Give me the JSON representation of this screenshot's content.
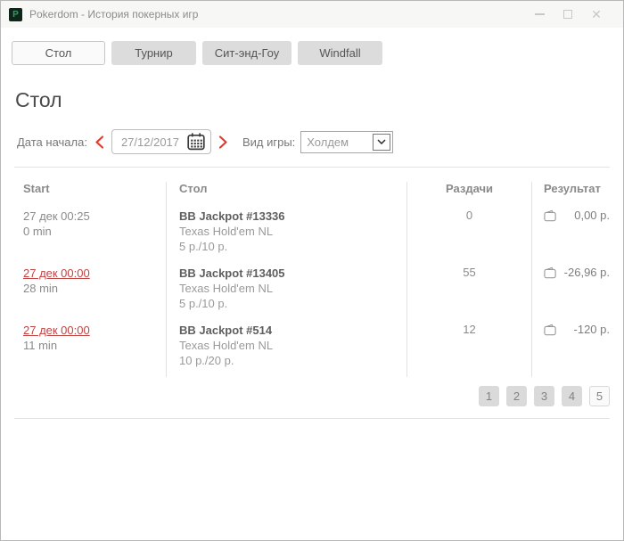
{
  "window": {
    "title": "Pokerdom - История покерных игр",
    "logo_letter": "P"
  },
  "tabs": [
    {
      "label": "Стол",
      "active": true
    },
    {
      "label": "Турнир",
      "active": false
    },
    {
      "label": "Сит-энд-Гоу",
      "active": false
    },
    {
      "label": "Windfall",
      "active": false
    }
  ],
  "page": {
    "heading": "Стол"
  },
  "filters": {
    "date_label": "Дата начала:",
    "date_value": "27/12/2017",
    "game_label": "Вид игры:",
    "game_value": "Холдем"
  },
  "table": {
    "headers": {
      "start": "Start",
      "table": "Стол",
      "hands": "Раздачи",
      "result": "Результат"
    },
    "rows": [
      {
        "start": "27 дек 00:25",
        "duration": "0 min",
        "name": "BB Jackpot #13336",
        "game": "Texas Hold'em NL",
        "stakes": "5 р./10 р.",
        "hands": "0",
        "result": "0,00 р."
      },
      {
        "start": "27 дек 00:00",
        "duration": "28 min",
        "name": "BB Jackpot #13405",
        "game": "Texas Hold'em NL",
        "stakes": "5 р./10 р.",
        "hands": "55",
        "result": "-26,96 р."
      },
      {
        "start": "27 дек 00:00",
        "duration": "11 min",
        "name": "BB Jackpot #514",
        "game": "Texas Hold'em NL",
        "stakes": "10 р./20 р.",
        "hands": "12",
        "result": "-120 р."
      }
    ]
  },
  "pagination": {
    "pages": [
      "1",
      "2",
      "3",
      "4",
      "5"
    ],
    "current_page": "5"
  },
  "icons": {
    "close": "✕",
    "wallet": "wallet-outline",
    "calendar": "calendar-grid",
    "prev": "chevron-left",
    "next": "chevron-right",
    "select_arrow": "chevron-down"
  },
  "colors": {
    "accent_red": "#e23b2e",
    "link_red": "#bf4545",
    "logo_green": "#2fa05e",
    "logo_bg": "#0f241a"
  }
}
